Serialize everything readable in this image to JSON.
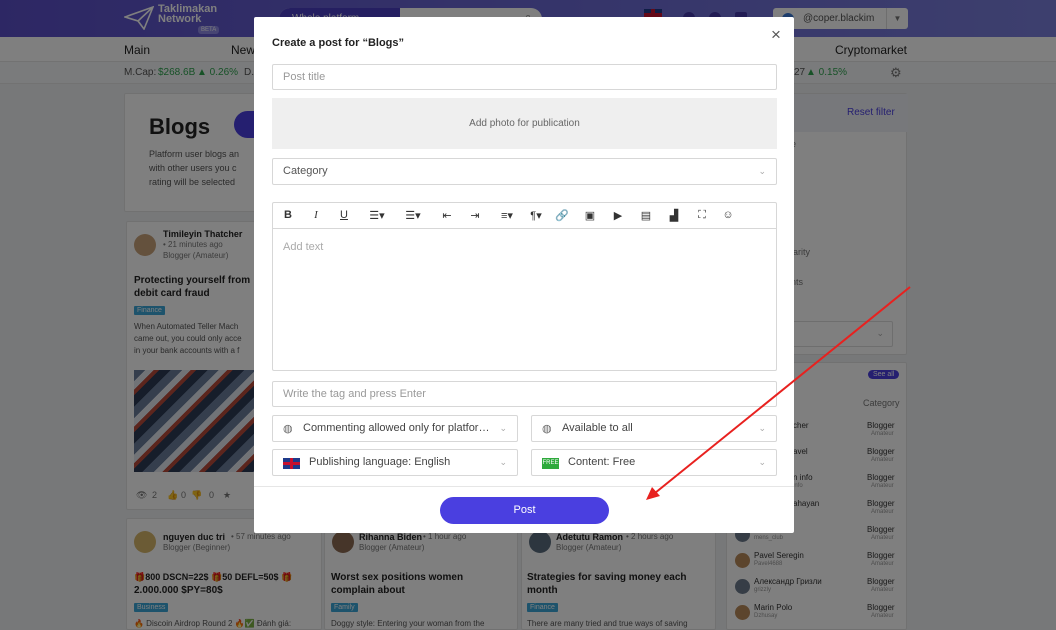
{
  "header": {
    "logo_line1": "Taklimakan",
    "logo_line2": "Network",
    "logo_badge": "BETA",
    "search_scope": "Whole platform",
    "username": "@coper.blackim"
  },
  "nav": {
    "items": [
      "Main",
      "New",
      "Cryptomarket"
    ]
  },
  "ticker": {
    "mcap_label": "M.Cap:",
    "mcap_value": "$268.6B",
    "mcap_change": "▲ 0.26%",
    "right_value": "27",
    "right_change": "▲ 0.15%",
    "d_label": "D."
  },
  "blogs_header": {
    "title": "Blogs",
    "desc_1": "Platform user blogs an",
    "desc_2": "with other users you c",
    "desc_3": "rating will be selected"
  },
  "filters": {
    "reset": "Reset filter",
    "frag1": "e",
    "frag2": "larity",
    "frag3": "nts"
  },
  "posts": [
    {
      "author": "Timileyin Thatcher",
      "time": "• 21 minutes ago",
      "role": "Blogger (Amateur)",
      "title_1": "Protecting yourself from",
      "title_2": "debit card fraud",
      "tag": "Finance",
      "text_1": "When Automated Teller Mach",
      "text_2": "came out, you could only acce",
      "text_3": "in your bank accounts with a f",
      "views": "2",
      "likes": "0",
      "dislikes": "0",
      "comments": "0"
    },
    {
      "author": "nguyen duc tri",
      "time": "• 57 minutes ago",
      "role": "Blogger (Beginner)",
      "title_1": "🎁800 DSCN=22$ 🎁50 DEFL=50$ 🎁",
      "title_2": "2.000.000 $PY=80$",
      "tag": "Business",
      "text_1": "🔥 Discoin Airdrop Round 2 🔥✅ Đánh giá:"
    },
    {
      "author": "Rihanna Biden",
      "time": "• 1 hour ago",
      "role": "Blogger (Amateur)",
      "title_1": "Worst sex positions women",
      "title_2": "complain about",
      "tag": "Family",
      "text_1": "Doggy style: Entering your woman from the"
    },
    {
      "author": "Adetutu Ramon",
      "time": "• 2 hours ago",
      "role": "Blogger (Amateur)",
      "title_1": "Strategies for saving money each",
      "title_2": "month",
      "tag": "Finance",
      "text_1": "There are many tried and true ways of saving"
    }
  ],
  "bloggers": {
    "see_all": "See all",
    "category_header": "Category",
    "rows": [
      {
        "name": "cher",
        "handle": "",
        "category": "Blogger",
        "level": "Amateur"
      },
      {
        "name": "avel",
        "handle": "",
        "category": "Blogger",
        "level": "Amateur"
      },
      {
        "name": "n info",
        "handle": "info",
        "category": "Blogger",
        "level": "Amateur"
      },
      {
        "name": "ahayan",
        "handle": "",
        "category": "Blogger",
        "level": "Amateur"
      },
      {
        "name": "Ахапкин",
        "handle": "mens_club",
        "category": "Blogger",
        "level": "Amateur"
      },
      {
        "name": "Pavel Seregin",
        "handle": "Pavel4688",
        "category": "Blogger",
        "level": "Amateur"
      },
      {
        "name": "Александр Гризли",
        "handle": "grizzly",
        "category": "Blogger",
        "level": "Amateur"
      },
      {
        "name": "Marin Polo",
        "handle": "Dzhusay",
        "category": "Blogger",
        "level": "Amateur"
      }
    ]
  },
  "modal": {
    "title": "Create a post for “Blogs”",
    "close": "×",
    "post_title_placeholder": "Post title",
    "add_photo": "Add photo for publication",
    "category_placeholder": "Category",
    "add_text_placeholder": "Add text",
    "tag_placeholder": "Write the tag and press Enter",
    "commenting": "Commenting allowed only for platform users",
    "availability": "Available to all",
    "language": "Publishing language: English",
    "content": "Content: Free",
    "free_badge": "FREE",
    "post_button": "Post",
    "toolbar_icons": [
      "bold-icon",
      "italic-icon",
      "underline-icon",
      "ordered-list-icon",
      "bullet-list-icon",
      "outdent-icon",
      "indent-icon",
      "align-icon",
      "paragraph-icon",
      "link-icon",
      "image-icon",
      "video-icon",
      "file-icon",
      "chart-icon",
      "fullscreen-icon",
      "emoji-icon"
    ]
  },
  "colors": {
    "accent": "#4a3fe0",
    "header_bg": "#5b4fc9",
    "annotation_arrow": "#e8211f"
  }
}
